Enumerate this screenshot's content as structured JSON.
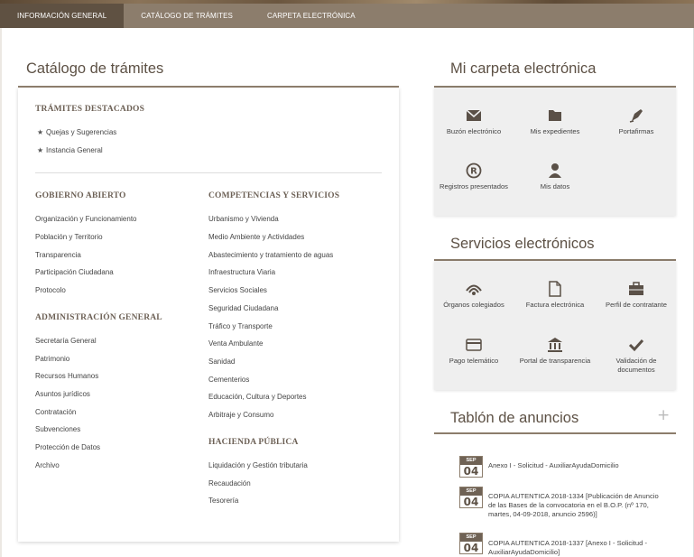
{
  "topnav": {
    "tabs": [
      {
        "label": "INFORMACIÓN GENERAL",
        "active": true
      },
      {
        "label": "CATÁLOGO DE TRÁMITES",
        "active": false
      },
      {
        "label": "CARPETA ELECTRÓNICA",
        "active": false
      }
    ]
  },
  "catalog": {
    "title": "Catálogo de trámites",
    "featured": {
      "heading": "TRÁMITES DESTACADOS",
      "items": [
        "Quejas y Sugerencias",
        "Instancia General"
      ]
    },
    "gobierno_abierto": {
      "heading": "GOBIERNO ABIERTO",
      "items": [
        "Organización y Funcionamiento",
        "Población y Territorio",
        "Transparencia",
        "Participación Ciudadana",
        "Protocolo"
      ]
    },
    "administracion_general": {
      "heading": "ADMINISTRACIÓN GENERAL",
      "items": [
        "Secretaría General",
        "Patrimonio",
        "Recursos Humanos",
        "Asuntos jurídicos",
        "Contratación",
        "Subvenciones",
        "Protección de Datos",
        "Archivo"
      ]
    },
    "competencias": {
      "heading": "COMPETENCIAS Y SERVICIOS",
      "items": [
        "Urbanismo y Vivienda",
        "Medio Ambiente y Actividades",
        "Abastecimiento y tratamiento de aguas",
        "Infraestructura Viaria",
        "Servicios Sociales",
        "Seguridad Ciudadana",
        "Tráfico y Transporte",
        "Venta Ambulante",
        "Sanidad",
        "Cementerios",
        "Educación, Cultura y Deportes",
        "Arbitraje y Consumo"
      ]
    },
    "hacienda": {
      "heading": "HACIENDA PÚBLICA",
      "items": [
        "Liquidación y Gestión tributaria",
        "Recaudación",
        "Tesorería"
      ]
    }
  },
  "carpeta": {
    "title": "Mi carpeta electrónica",
    "tiles": [
      {
        "label": "Buzón electrónico",
        "icon": "envelope-icon"
      },
      {
        "label": "Mis expedientes",
        "icon": "folder-icon"
      },
      {
        "label": "Portafirmas",
        "icon": "pen-icon"
      },
      {
        "label": "Registros presentados",
        "icon": "registered-icon"
      },
      {
        "label": "Mis datos",
        "icon": "user-icon"
      }
    ]
  },
  "servicios": {
    "title": "Servicios electrónicos",
    "tiles": [
      {
        "label": "Órganos colegiados",
        "icon": "signal-icon"
      },
      {
        "label": "Factura electrónica",
        "icon": "document-icon"
      },
      {
        "label": "Perfil de contratante",
        "icon": "briefcase-icon"
      },
      {
        "label": "Pago telemático",
        "icon": "credit-card-icon"
      },
      {
        "label": "Portal de transparencia",
        "icon": "institution-icon"
      },
      {
        "label": "Validación de documentos",
        "icon": "checkmark-icon"
      }
    ]
  },
  "tablon": {
    "title": "Tablón de anuncios",
    "plus": "+",
    "notices": [
      {
        "month": "SEP",
        "day": "04",
        "text": "Anexo I - Solicitud - AuxiliarAyudaDomicilio"
      },
      {
        "month": "SEP",
        "day": "04",
        "text": "COPIA AUTENTICA 2018-1334 [Publicación de Anuncio de las Bases de la convocatoria en el B.O.P. (nº 170, martes, 04-09-2018, anuncio 2596)]"
      },
      {
        "month": "SEP",
        "day": "04",
        "text": "COPIA AUTENTICA 2018-1337 [Anexo I - Solicitud - AuxiliarAyudaDomicilio]"
      }
    ]
  },
  "colors": {
    "nav": "#8c7d6c",
    "nav_active": "#5f5142",
    "heading": "#6d6156",
    "title": "#5d5145",
    "icon": "#5a5047"
  }
}
